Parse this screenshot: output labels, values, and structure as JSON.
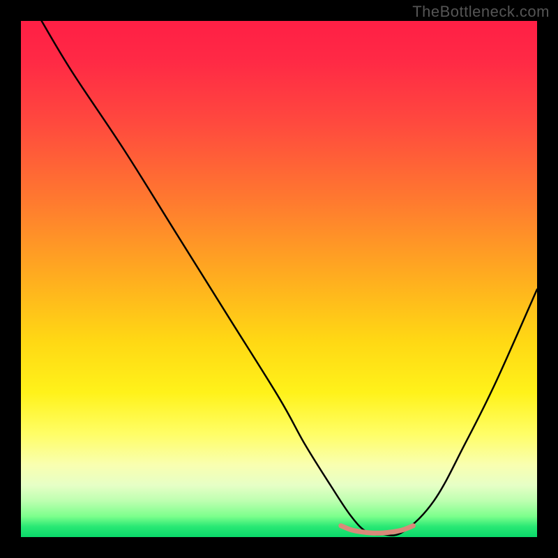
{
  "watermark": "TheBottleneck.com",
  "chart_data": {
    "type": "line",
    "title": "",
    "xlabel": "",
    "ylabel": "",
    "xlim": [
      0,
      100
    ],
    "ylim": [
      0,
      100
    ],
    "grid": false,
    "legend": false,
    "series": [
      {
        "name": "bottleneck-curve",
        "x": [
          4,
          10,
          20,
          30,
          40,
          50,
          55,
          60,
          64,
          67,
          70,
          74,
          80,
          86,
          92,
          100
        ],
        "y": [
          100,
          90,
          75,
          59,
          43,
          27,
          18,
          10,
          4,
          1,
          0.5,
          1,
          7,
          18,
          30,
          48
        ],
        "color": "#000000"
      },
      {
        "name": "sweet-spot",
        "x": [
          62,
          64,
          66,
          68,
          70,
          72,
          74,
          76
        ],
        "y": [
          2.2,
          1.4,
          1.0,
          0.8,
          0.8,
          1.0,
          1.4,
          2.2
        ],
        "color": "#d98a7a"
      }
    ],
    "gradient_stops": [
      {
        "pos": 0,
        "color": "#ff1f45"
      },
      {
        "pos": 20,
        "color": "#ff4a3e"
      },
      {
        "pos": 50,
        "color": "#ffae1f"
      },
      {
        "pos": 72,
        "color": "#fff21a"
      },
      {
        "pos": 90,
        "color": "#e6ffc6"
      },
      {
        "pos": 100,
        "color": "#0ad96a"
      }
    ]
  }
}
